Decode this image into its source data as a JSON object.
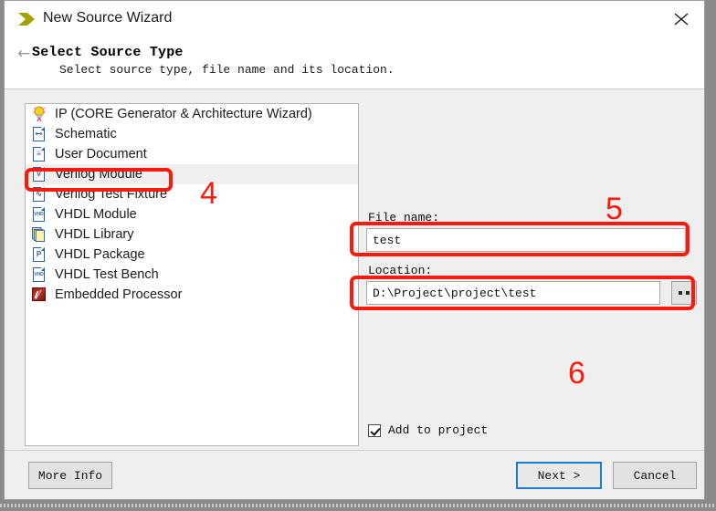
{
  "window": {
    "title": "New Source Wizard",
    "title_icon": "green-arrow-icon",
    "close_label": "✕"
  },
  "header": {
    "back_arrow": "←",
    "title": "Select Source Type",
    "subtitle": "Select source type, file name and its location."
  },
  "source_list": {
    "selected": "Verilog Module",
    "items": [
      {
        "label": "IP (CORE Generator & Architecture Wizard)",
        "icon": "lightbulb-icon",
        "glyph": ""
      },
      {
        "label": "Schematic",
        "icon": "schematic-document-icon",
        "glyph": "⊷"
      },
      {
        "label": "User Document",
        "icon": "text-document-icon",
        "glyph": "≡"
      },
      {
        "label": "Verilog Module",
        "icon": "verilog-module-icon",
        "glyph": "V"
      },
      {
        "label": "Verilog Test Fixture",
        "icon": "verilog-test-fixture-icon",
        "glyph": "∿"
      },
      {
        "label": "VHDL Module",
        "icon": "vhdl-module-icon",
        "glyph": "VHD"
      },
      {
        "label": "VHDL Library",
        "icon": "vhdl-library-icon",
        "glyph": ""
      },
      {
        "label": "VHDL Package",
        "icon": "vhdl-package-icon",
        "glyph": "P"
      },
      {
        "label": "VHDL Test Bench",
        "icon": "vhdl-test-bench-icon",
        "glyph": "VHD"
      },
      {
        "label": "Embedded Processor",
        "icon": "embedded-processor-icon",
        "glyph": ""
      }
    ]
  },
  "form": {
    "file_name_label": "File name:",
    "file_name_value": "test",
    "location_label": "Location:",
    "location_value": "D:\\Project\\project\\test",
    "browse_label": "...",
    "add_to_project_label": "Add to project",
    "add_to_project_checked": true
  },
  "footer": {
    "more_info_label": "More Info",
    "next_label": "Next >",
    "cancel_label": "Cancel"
  },
  "annotations": {
    "step4": "4",
    "step5": "5",
    "step6": "6",
    "color": "#fb1a0c"
  }
}
